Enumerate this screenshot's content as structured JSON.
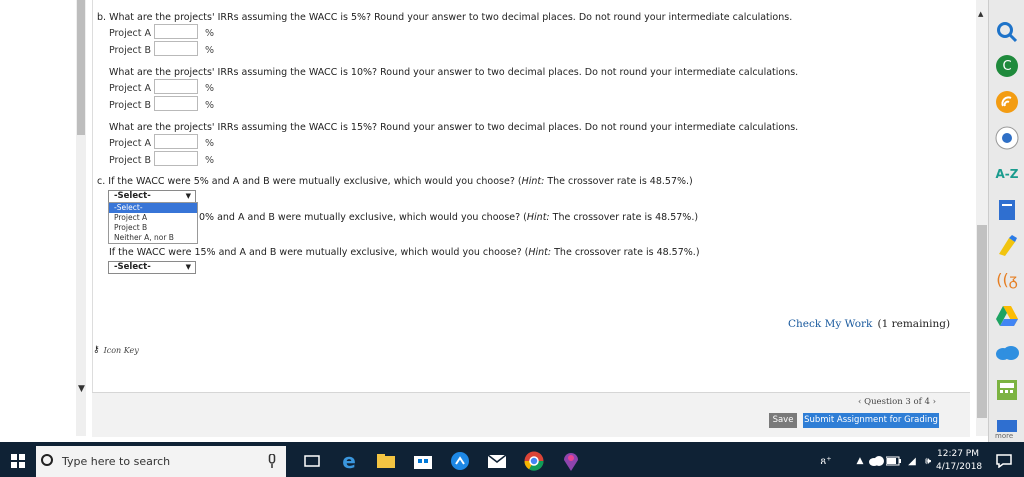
{
  "content": {
    "part_b": {
      "q1": "b. What are the projects' IRRs assuming the WACC is 5%? Round your answer to two decimal places. Do not round your intermediate calculations.",
      "q2": "What are the projects' IRRs assuming the WACC is 10%? Round your answer to two decimal places. Do not round your intermediate calculations.",
      "q3": "What are the projects' IRRs assuming the WACC is 15%? Round your answer to two decimal places. Do not round your intermediate calculations.",
      "project_a": "Project A",
      "project_b": "Project B",
      "percent": "%"
    },
    "part_c": {
      "q1_prefix": "c. If the WACC were 5% and A and B were mutually exclusive, which would you choose? (",
      "hint_word": "Hint:",
      "q_suffix": " The crossover rate is 48.57%.)",
      "q2_visible": "0% and A and B were mutually exclusive, which would you choose? (",
      "q3_prefix": "If the WACC were 15% and A and B were mutually exclusive, which would you choose? (",
      "select_value_1": "-Select-",
      "select_value_3": "-Select-",
      "dropdown_options": [
        "-Select-",
        "Project A",
        "Project B",
        "Neither A, nor B"
      ]
    },
    "check_work_label": "Check My Work",
    "check_work_remaining": "(1 remaining)",
    "icon_key_label": "Icon Key"
  },
  "footer": {
    "pager": "Question 3 of 4",
    "save_label": "Save",
    "submit_label": "Submit Assignment for Grading"
  },
  "dock": {
    "az_label": "A-Z",
    "more_label": "more"
  },
  "taskbar": {
    "search_placeholder": "Type here to search",
    "time": "12:27 PM",
    "date": "4/17/2018"
  },
  "colors": {
    "link_blue": "#1a5a9e",
    "submit_blue": "#2f7ed6",
    "taskbar_bg": "#0f2235",
    "select_highlight": "#3875d7"
  }
}
